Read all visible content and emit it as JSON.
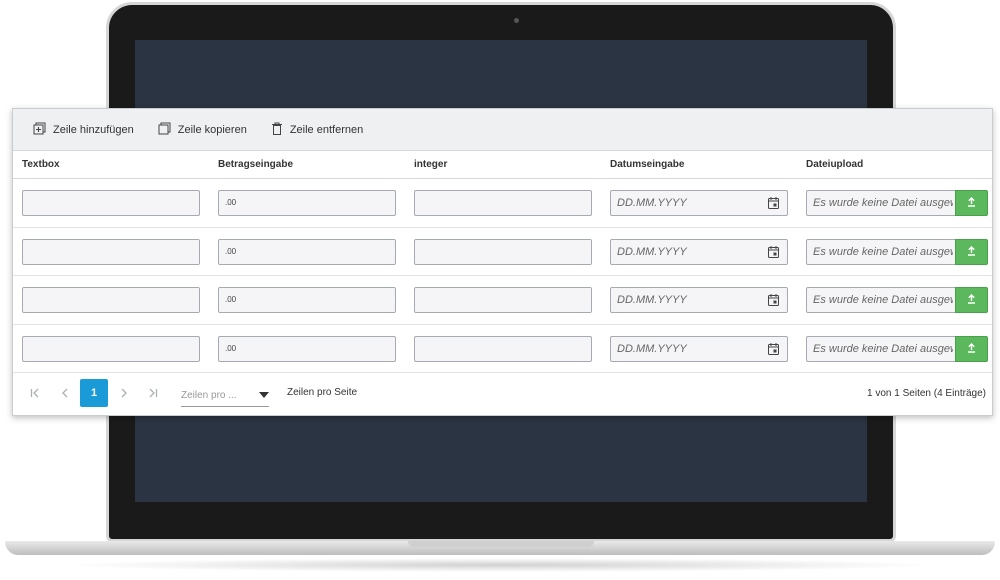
{
  "toolbar": {
    "add_row": "Zeile hinzufügen",
    "copy_row": "Zeile kopieren",
    "remove_row": "Zeile entfernen"
  },
  "columns": [
    "Textbox",
    "Betragseingabe",
    "integer",
    "Datumseingabe",
    "Dateiupload"
  ],
  "rows": [
    {
      "textbox": "",
      "amount_symbol": ".00",
      "integer": "",
      "date_placeholder": "DD.MM.YYYY",
      "file_placeholder": "Es wurde keine Datei ausgewählt"
    },
    {
      "textbox": "",
      "amount_symbol": ".00",
      "integer": "",
      "date_placeholder": "DD.MM.YYYY",
      "file_placeholder": "Es wurde keine Datei ausgewählt"
    },
    {
      "textbox": "",
      "amount_symbol": ".00",
      "integer": "",
      "date_placeholder": "DD.MM.YYYY",
      "file_placeholder": "Es wurde keine Datei ausgewählt"
    },
    {
      "textbox": "",
      "amount_symbol": ".00",
      "integer": "",
      "date_placeholder": "DD.MM.YYYY",
      "file_placeholder": "Es wurde keine Datei ausgewählt"
    }
  ],
  "pager": {
    "current_page": "1",
    "page_size_placeholder": "Zeilen pro ...",
    "page_size_label": "Zeilen pro Seite",
    "info": "1 von 1 Seiten (4 Einträge)"
  },
  "colors": {
    "accent": "#1a9bd8",
    "upload": "#5cb85c",
    "toolbar_bg": "#eef0f2",
    "screen": "#2b3442"
  },
  "icons": [
    "add-row-icon",
    "copy-row-icon",
    "trash-icon",
    "calendar-icon",
    "upload-icon",
    "first-page-icon",
    "prev-page-icon",
    "next-page-icon",
    "last-page-icon",
    "dropdown-arrow-icon"
  ]
}
